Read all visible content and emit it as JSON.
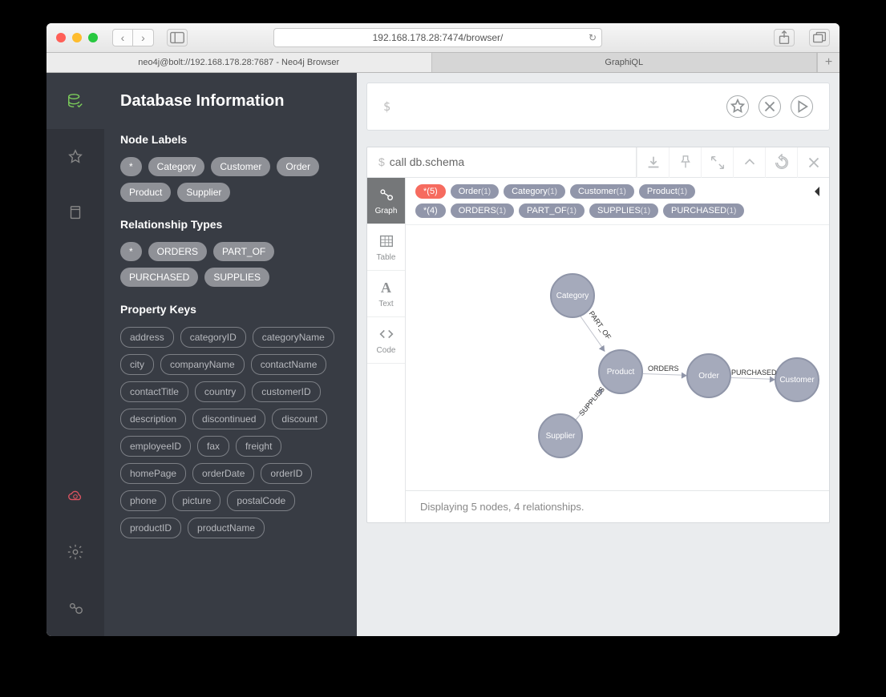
{
  "browser": {
    "url": "192.168.178.28:7474/browser/"
  },
  "tabs": [
    "neo4j@bolt://192.168.178.28:7687 - Neo4j Browser",
    "GraphiQL"
  ],
  "drawer": {
    "title": "Database Information",
    "sections": {
      "nodelabels": {
        "title": "Node Labels",
        "items": [
          "*",
          "Category",
          "Customer",
          "Order",
          "Product",
          "Supplier"
        ]
      },
      "reltypes": {
        "title": "Relationship Types",
        "items": [
          "*",
          "ORDERS",
          "PART_OF",
          "PURCHASED",
          "SUPPLIES"
        ]
      },
      "propkeys": {
        "title": "Property Keys",
        "items": [
          "address",
          "categoryID",
          "categoryName",
          "city",
          "companyName",
          "contactName",
          "contactTitle",
          "country",
          "customerID",
          "description",
          "discontinued",
          "discount",
          "employeeID",
          "fax",
          "freight",
          "homePage",
          "orderDate",
          "orderID",
          "phone",
          "picture",
          "postalCode",
          "productID",
          "productName"
        ]
      }
    }
  },
  "editor": {
    "prompt": "$"
  },
  "frame": {
    "query": "call db.schema",
    "legend": {
      "nodes": [
        {
          "t": "*(5)",
          "red": true
        },
        {
          "t": "Order",
          "c": "(1)"
        },
        {
          "t": "Category",
          "c": "(1)"
        },
        {
          "t": "Customer",
          "c": "(1)"
        },
        {
          "t": "Product",
          "c": "(1)"
        }
      ],
      "rels": [
        {
          "t": "*(4)"
        },
        {
          "t": "ORDERS",
          "c": "(1)"
        },
        {
          "t": "PART_OF",
          "c": "(1)"
        },
        {
          "t": "SUPPLIES",
          "c": "(1)"
        },
        {
          "t": "PURCHASED",
          "c": "(1)"
        }
      ]
    },
    "graph": {
      "nodes": {
        "category": "Category",
        "product": "Product",
        "order": "Order",
        "customer": "Customer",
        "supplier": "Supplier"
      },
      "edges": {
        "partof": "PART_OF",
        "orders": "ORDERS",
        "purchased": "PURCHASED",
        "supplies": "SUPPLIES"
      }
    },
    "tabs": [
      "Graph",
      "Table",
      "Text",
      "Code"
    ],
    "status": "Displaying 5 nodes, 4 relationships."
  }
}
